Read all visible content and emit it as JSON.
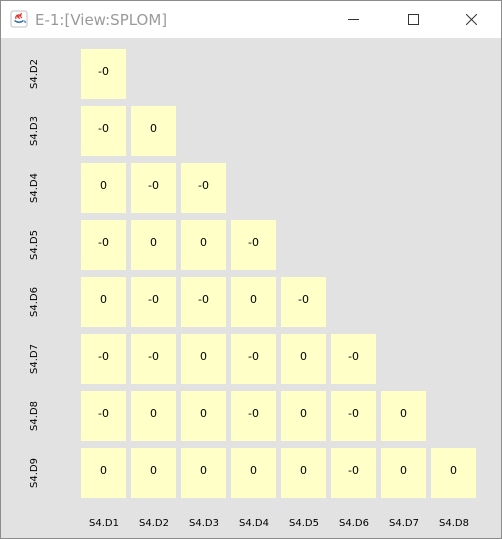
{
  "window": {
    "title": "E-1:[View:SPLOM]",
    "icon": "java-cup-icon",
    "controls": [
      "minimize-icon",
      "maximize-icon",
      "close-icon"
    ]
  },
  "splom": {
    "row_labels": [
      "S4.D2",
      "S4.D3",
      "S4.D4",
      "S4.D5",
      "S4.D6",
      "S4.D7",
      "S4.D8",
      "S4.D9"
    ],
    "col_labels": [
      "S4.D1",
      "S4.D2",
      "S4.D3",
      "S4.D4",
      "S4.D5",
      "S4.D6",
      "S4.D7",
      "S4.D8"
    ],
    "cell_color": "#ffffc8",
    "cells": [
      [
        "-0"
      ],
      [
        "-0",
        "0"
      ],
      [
        "0",
        "-0",
        "-0"
      ],
      [
        "-0",
        "0",
        "0",
        "-0"
      ],
      [
        "0",
        "-0",
        "-0",
        "0",
        "-0"
      ],
      [
        "-0",
        "-0",
        "0",
        "-0",
        "0",
        "-0"
      ],
      [
        "-0",
        "0",
        "0",
        "-0",
        "0",
        "-0",
        "0"
      ],
      [
        "0",
        "0",
        "0",
        "0",
        "0",
        "-0",
        "0",
        "0"
      ]
    ]
  }
}
